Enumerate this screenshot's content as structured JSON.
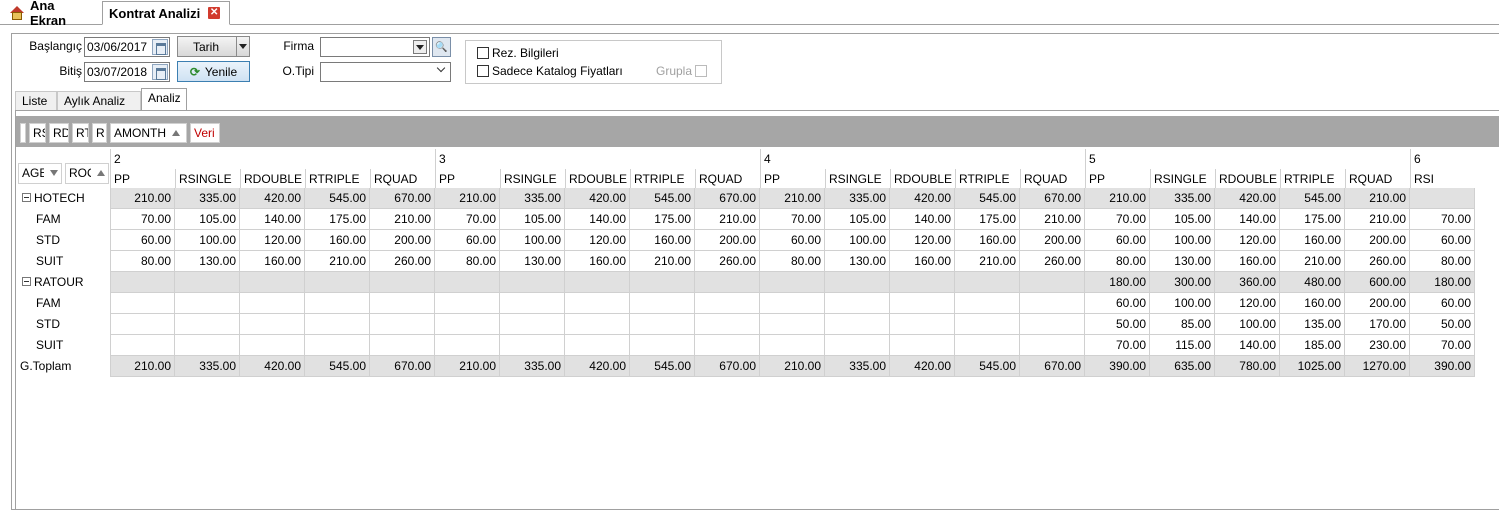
{
  "doc_tabs": {
    "home": "Ana Ekran",
    "active": "Kontrat Analizi"
  },
  "form": {
    "start_label": "Başlangıç",
    "start_value": "03/06/2017",
    "end_label": "Bitiş",
    "end_value": "03/07/2018",
    "date_button": "Tarih",
    "refresh_button": "Yenile",
    "firma_label": "Firma",
    "firma_value": "",
    "otipi_label": "O.Tipi",
    "otipi_value": "",
    "rez_label": "Rez. Bilgileri",
    "katalog_label": "Sadece Katalog Fiyatları",
    "grupla_label": "Grupla"
  },
  "panel_tabs": [
    "Liste",
    "Aylık Analiz",
    "Analiz"
  ],
  "pivot": {
    "filter_fields": [
      "RS",
      "RD",
      "RT",
      "R",
      "AMONTH",
      "Veri"
    ],
    "row_fields": [
      "AGE",
      "ROO"
    ],
    "months": [
      "2",
      "3",
      "4",
      "5",
      "6"
    ],
    "measures": [
      "PP",
      "RSINGLE",
      "RDOUBLE",
      "RTRIPLE",
      "RQUAD"
    ],
    "rows": [
      {
        "label": "HOTECH",
        "group": true,
        "values": [
          "210.00",
          "335.00",
          "420.00",
          "545.00",
          "670.00",
          "210.00",
          "335.00",
          "420.00",
          "545.00",
          "670.00",
          "210.00",
          "335.00",
          "420.00",
          "545.00",
          "670.00",
          "210.00",
          "335.00",
          "420.00",
          "545.00",
          "210.00"
        ]
      },
      {
        "label": "FAM",
        "group": false,
        "values": [
          "70.00",
          "105.00",
          "140.00",
          "175.00",
          "210.00",
          "70.00",
          "105.00",
          "140.00",
          "175.00",
          "210.00",
          "70.00",
          "105.00",
          "140.00",
          "175.00",
          "210.00",
          "70.00",
          "105.00",
          "140.00",
          "175.00",
          "210.00",
          "70.00"
        ]
      },
      {
        "label": "STD",
        "group": false,
        "values": [
          "60.00",
          "100.00",
          "120.00",
          "160.00",
          "200.00",
          "60.00",
          "100.00",
          "120.00",
          "160.00",
          "200.00",
          "60.00",
          "100.00",
          "120.00",
          "160.00",
          "200.00",
          "60.00",
          "100.00",
          "120.00",
          "160.00",
          "200.00",
          "60.00"
        ]
      },
      {
        "label": "SUIT",
        "group": false,
        "values": [
          "80.00",
          "130.00",
          "160.00",
          "210.00",
          "260.00",
          "80.00",
          "130.00",
          "160.00",
          "210.00",
          "260.00",
          "80.00",
          "130.00",
          "160.00",
          "210.00",
          "260.00",
          "80.00",
          "130.00",
          "160.00",
          "210.00",
          "260.00",
          "80.00"
        ]
      },
      {
        "label": "RATOUR",
        "group": true,
        "values": [
          "",
          "",
          "",
          "",
          "",
          "",
          "",
          "",
          "",
          "",
          "",
          "",
          "",
          "",
          "",
          "180.00",
          "300.00",
          "360.00",
          "480.00",
          "600.00",
          "180.00"
        ]
      },
      {
        "label": "FAM",
        "group": false,
        "values": [
          "",
          "",
          "",
          "",
          "",
          "",
          "",
          "",
          "",
          "",
          "",
          "",
          "",
          "",
          "",
          "60.00",
          "100.00",
          "120.00",
          "160.00",
          "200.00",
          "60.00"
        ]
      },
      {
        "label": "STD",
        "group": false,
        "values": [
          "",
          "",
          "",
          "",
          "",
          "",
          "",
          "",
          "",
          "",
          "",
          "",
          "",
          "",
          "",
          "50.00",
          "85.00",
          "100.00",
          "135.00",
          "170.00",
          "50.00"
        ]
      },
      {
        "label": "SUIT",
        "group": false,
        "values": [
          "",
          "",
          "",
          "",
          "",
          "",
          "",
          "",
          "",
          "",
          "",
          "",
          "",
          "",
          "",
          "70.00",
          "115.00",
          "140.00",
          "185.00",
          "230.00",
          "70.00"
        ]
      },
      {
        "label": "G.Toplam",
        "group": true,
        "total": true,
        "values": [
          "210.00",
          "335.00",
          "420.00",
          "545.00",
          "670.00",
          "210.00",
          "335.00",
          "420.00",
          "545.00",
          "670.00",
          "210.00",
          "335.00",
          "420.00",
          "545.00",
          "670.00",
          "390.00",
          "635.00",
          "780.00",
          "1025.00",
          "1270.00",
          "390.00"
        ]
      }
    ],
    "partial_measure": "RSI"
  }
}
